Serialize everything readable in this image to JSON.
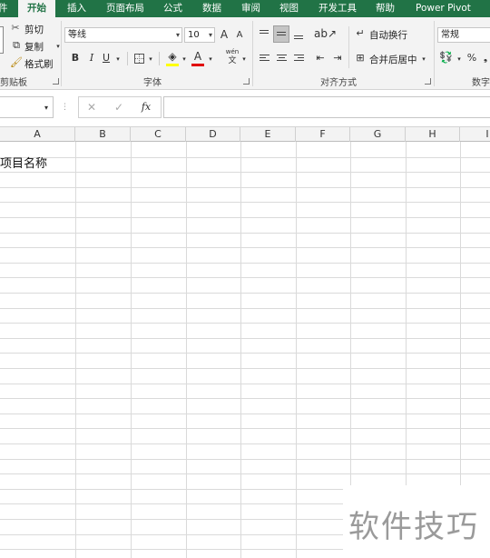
{
  "tabs": {
    "file_partial": "件",
    "items": [
      "开始",
      "插入",
      "页面布局",
      "公式",
      "数据",
      "审阅",
      "视图",
      "开发工具",
      "帮助",
      "Power Pivot"
    ]
  },
  "clipboard": {
    "cut": "剪切",
    "copy": "复制",
    "format_painter": "格式刷",
    "label": "剪贴板"
  },
  "font": {
    "name": "等线",
    "size": "10",
    "bold": "B",
    "italic": "I",
    "underline": "U",
    "grow": "A",
    "shrink": "A",
    "font_color_glyph": "A",
    "phonetic_top": "wén",
    "phonetic_bottom": "文",
    "label": "字体"
  },
  "alignment": {
    "wrap_text": "自动换行",
    "merge_center": "合并后居中",
    "label": "对齐方式"
  },
  "number": {
    "format": "常规",
    "percent": "%",
    "label": "数字"
  },
  "formula_bar": {
    "fx": "fx",
    "cancel": "✕",
    "enter": "✓",
    "value": ""
  },
  "sheet": {
    "columns": [
      "A",
      "B",
      "C",
      "D",
      "E",
      "F",
      "G",
      "H",
      "I"
    ],
    "a1_value": "项目名称"
  },
  "watermark": "软件技巧",
  "colors": {
    "brand_green": "#217346",
    "fill_yellow": "#ffff00",
    "font_red": "#e00000"
  }
}
